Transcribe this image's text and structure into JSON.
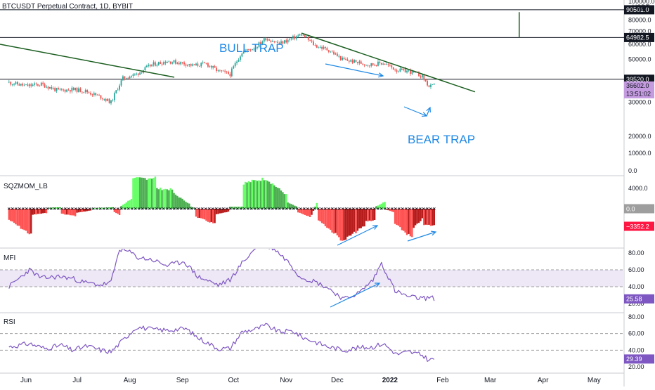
{
  "header": {
    "title": "BTCUSDT Perpetual Contract, 1D, BYBIT",
    "currency": "USDT"
  },
  "annotations": {
    "bull_trap": "BULL TRAP",
    "bear_trap": "BEAR TRAP"
  },
  "colors": {
    "up": "#26a69a",
    "down": "#ef5350",
    "trendline": "#1b5e20",
    "annotation": "#1e88e5",
    "indicator_line": "#7e57c2",
    "band_fill": "#ede7f6",
    "sqz_bright_green": "#66ff66",
    "sqz_dark_green": "#4caf50",
    "sqz_bright_red": "#ff5252",
    "sqz_dark_red": "#b71c1c"
  },
  "price_pane": {
    "yscale": "log",
    "ticks": [
      {
        "value": 100000,
        "label": "100000.0"
      },
      {
        "value": 80000,
        "label": "80000.0"
      },
      {
        "value": 70000,
        "label": "70000.0"
      },
      {
        "value": 60000,
        "label": "60000.0"
      },
      {
        "value": 50000,
        "label": "50000.0"
      },
      {
        "value": 30000,
        "label": "30000.0"
      },
      {
        "value": 20000,
        "label": "20000.0"
      },
      {
        "value": 10000,
        "label": "10000.0"
      },
      {
        "value": 0,
        "label": "0.0"
      }
    ],
    "levels": [
      {
        "value": 90501,
        "label": "90501.0"
      },
      {
        "value": 64982.5,
        "label": "64982.5"
      },
      {
        "value": 39520,
        "label": "39520.0"
      }
    ],
    "last_price": {
      "value": 36602,
      "label": "36602.0",
      "countdown": "13:51:02"
    }
  },
  "sqz_pane": {
    "name": "SQZMOM_LB",
    "ticks": [
      {
        "value": 4000,
        "label": "4000.0"
      }
    ],
    "badges": [
      {
        "value": 0,
        "label": "0.0"
      },
      {
        "value": -3352.2,
        "label": "−3352.2"
      }
    ]
  },
  "mfi_pane": {
    "name": "MFI",
    "ticks": [
      {
        "value": 80,
        "label": "80.00"
      },
      {
        "value": 60,
        "label": "60.00"
      },
      {
        "value": 40,
        "label": "40.00"
      },
      {
        "value": 20,
        "label": "20.00"
      }
    ],
    "value_label": "25.58"
  },
  "rsi_pane": {
    "name": "RSI",
    "ticks": [
      {
        "value": 80,
        "label": "80.00"
      },
      {
        "value": 60,
        "label": "60.00"
      },
      {
        "value": 40,
        "label": "40.00"
      },
      {
        "value": 20,
        "label": "20.00"
      }
    ],
    "value_label": "29.39"
  },
  "chart_data": {
    "type": "line",
    "x_axis": [
      "Jun",
      "Jul",
      "Aug",
      "Sep",
      "Oct",
      "Nov",
      "Dec",
      "2022",
      "Feb",
      "Mar",
      "Apr",
      "May"
    ],
    "series": [
      {
        "x": [
          "2021-05-22",
          "2021-06-01",
          "2021-06-10",
          "2021-06-20",
          "2021-06-28",
          "2021-07-05",
          "2021-07-15",
          "2021-07-21",
          "2021-07-28",
          "2021-08-05",
          "2021-08-14",
          "2021-08-23",
          "2021-09-01",
          "2021-09-07",
          "2021-09-15",
          "2021-09-22",
          "2021-09-29",
          "2021-10-06",
          "2021-10-14",
          "2021-10-20",
          "2021-10-28",
          "2021-11-03",
          "2021-11-10",
          "2021-11-18",
          "2021-11-26",
          "2021-12-04",
          "2021-12-12",
          "2021-12-20",
          "2021-12-28",
          "2022-01-05",
          "2022-01-12",
          "2022-01-20",
          "2022-01-24",
          "2022-01-27"
        ],
        "values": [
          38000,
          36500,
          37200,
          34500,
          35000,
          34500,
          32000,
          30000,
          40000,
          42000,
          47000,
          49000,
          48000,
          46500,
          47500,
          43500,
          42000,
          54500,
          58000,
          64500,
          60500,
          63500,
          67500,
          59000,
          56000,
          50000,
          48500,
          47000,
          48000,
          44000,
          43500,
          41000,
          36000,
          36602
        ]
      },
      {
        "x": [
          "2021-05-22",
          "2021-06-03",
          "2021-06-10",
          "2021-06-20",
          "2021-06-28",
          "2021-07-05",
          "2021-07-15",
          "2021-07-21",
          "2021-07-26",
          "2021-08-02",
          "2021-08-05",
          "2021-08-14",
          "2021-08-23",
          "2021-09-02",
          "2021-09-10",
          "2021-09-22",
          "2021-09-29",
          "2021-10-06",
          "2021-10-16",
          "2021-10-25",
          "2021-11-03",
          "2021-11-09",
          "2021-11-18",
          "2021-11-26",
          "2021-12-05",
          "2021-12-14",
          "2021-12-22",
          "2021-12-27",
          "2022-01-04",
          "2022-01-12",
          "2022-01-20",
          "2022-01-24",
          "2022-01-27"
        ],
        "values": [
          40,
          60,
          50,
          52,
          50,
          45,
          42,
          45,
          85,
          80,
          75,
          72,
          65,
          70,
          52,
          42,
          48,
          68,
          90,
          85,
          68,
          52,
          46,
          38,
          25,
          33,
          48,
          68,
          35,
          28,
          26,
          27,
          26
        ]
      },
      {
        "x": [
          "2021-05-22",
          "2021-06-03",
          "2021-06-12",
          "2021-06-22",
          "2021-06-28",
          "2021-07-07",
          "2021-07-15",
          "2021-07-21",
          "2021-07-28",
          "2021-08-05",
          "2021-08-14",
          "2021-08-23",
          "2021-09-03",
          "2021-09-10",
          "2021-09-22",
          "2021-09-29",
          "2021-10-06",
          "2021-10-15",
          "2021-10-20",
          "2021-10-28",
          "2021-11-05",
          "2021-11-10",
          "2021-11-18",
          "2021-11-26",
          "2021-12-05",
          "2021-12-14",
          "2021-12-22",
          "2021-12-28",
          "2022-01-05",
          "2022-01-12",
          "2022-01-20",
          "2022-01-24",
          "2022-01-27"
        ],
        "values": [
          44,
          48,
          42,
          46,
          40,
          45,
          40,
          38,
          52,
          68,
          65,
          64,
          66,
          55,
          42,
          42,
          62,
          66,
          70,
          62,
          63,
          56,
          50,
          44,
          40,
          43,
          44,
          48,
          35,
          38,
          34,
          28,
          29.39
        ]
      }
    ]
  }
}
